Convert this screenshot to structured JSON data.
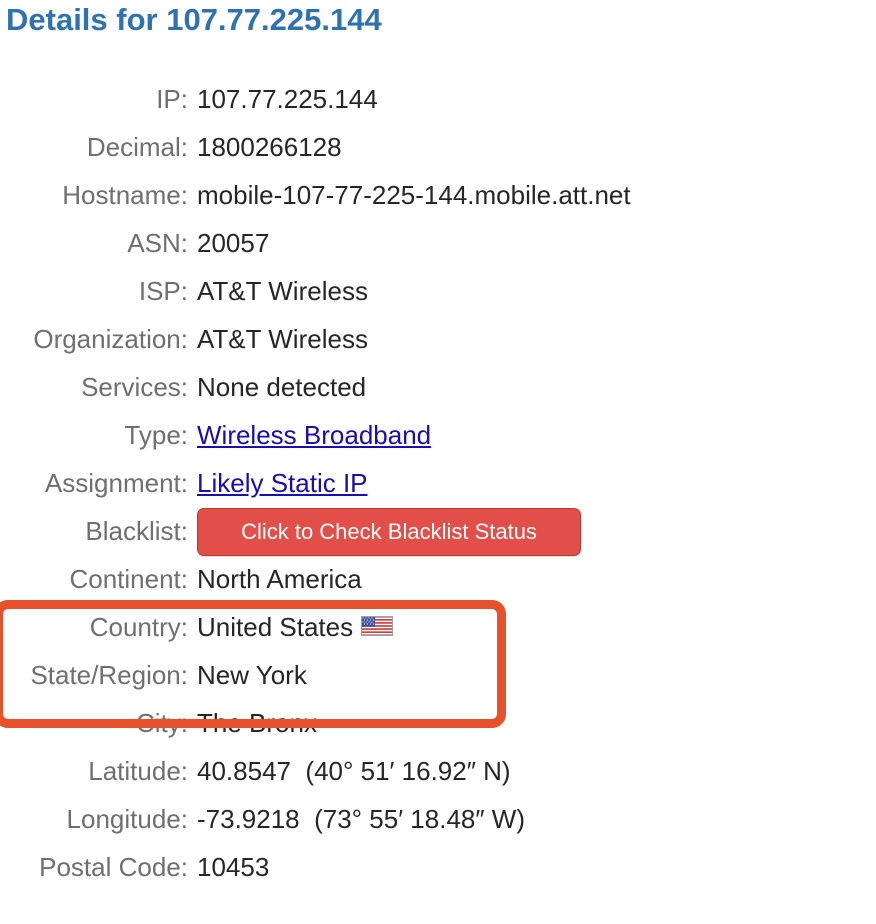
{
  "title": "Details for 107.77.225.144",
  "fields": {
    "ip": {
      "label": "IP:",
      "value": "107.77.225.144"
    },
    "decimal": {
      "label": "Decimal:",
      "value": "1800266128"
    },
    "hostname": {
      "label": "Hostname:",
      "value": "mobile-107-77-225-144.mobile.att.net"
    },
    "asn": {
      "label": "ASN:",
      "value": "20057"
    },
    "isp": {
      "label": "ISP:",
      "value": "AT&T Wireless"
    },
    "organization": {
      "label": "Organization:",
      "value": "AT&T Wireless"
    },
    "services": {
      "label": "Services:",
      "value": "None detected"
    },
    "type": {
      "label": "Type:",
      "value": "Wireless Broadband"
    },
    "assignment": {
      "label": "Assignment:",
      "value": "Likely Static IP"
    },
    "blacklist": {
      "label": "Blacklist:",
      "button_label": "Click to Check Blacklist Status"
    },
    "continent": {
      "label": "Continent:",
      "value": "North America"
    },
    "country": {
      "label": "Country:",
      "value": "United States",
      "flag_icon": "us-flag-icon"
    },
    "state_region": {
      "label": "State/Region:",
      "value": "New York"
    },
    "city": {
      "label": "City:",
      "value": "The Bronx"
    },
    "latitude": {
      "label": "Latitude:",
      "value": "40.8547  (40° 51′ 16.92″ N)"
    },
    "longitude": {
      "label": "Longitude:",
      "value": "-73.9218  (73° 55′ 18.48″ W)"
    },
    "postal_code": {
      "label": "Postal Code:",
      "value": "10453"
    }
  },
  "colors": {
    "title": "#2f72b2",
    "label": "#6f6f6f",
    "value": "#262626",
    "link": "#1a0dab",
    "blacklist_button": "#e24f48",
    "highlight_box": "#e8522a"
  }
}
